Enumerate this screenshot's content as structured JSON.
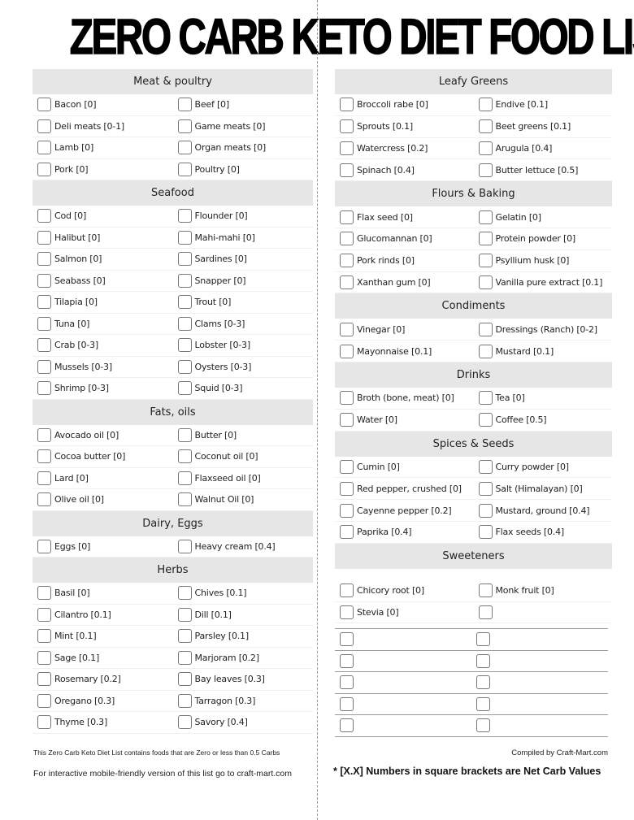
{
  "title": "ZERO CARB KETO DIET FOOD LIST",
  "left_column": [
    {
      "category": "Meat & poultry",
      "items": [
        "Bacon [0]",
        "Beef [0]",
        "Deli meats [0-1]",
        "Game meats [0]",
        "Lamb [0]",
        "Organ meats [0]",
        "Pork [0]",
        "Poultry [0]"
      ]
    },
    {
      "category": "Seafood",
      "items": [
        "Cod [0]",
        "Flounder [0]",
        "Halibut [0]",
        "Mahi-mahi [0]",
        "Salmon [0]",
        "Sardines [0]",
        "Seabass [0]",
        "Snapper [0]",
        "Tilapia [0]",
        "Trout [0]",
        "Tuna [0]",
        "Clams [0-3]",
        "Crab [0-3]",
        "Lobster [0-3]",
        "Mussels [0-3]",
        "Oysters [0-3]",
        "Shrimp [0-3]",
        "Squid [0-3]"
      ]
    },
    {
      "category": "Fats, oils",
      "items": [
        "Avocado oil [0]",
        "Butter [0]",
        "Cocoa butter [0]",
        "Coconut oil [0]",
        "Lard [0]",
        "Flaxseed oil [0]",
        "Olive oil [0]",
        "Walnut Oil [0]"
      ]
    },
    {
      "category": "Dairy, Eggs",
      "items": [
        "Eggs [0]",
        "Heavy cream [0.4]"
      ]
    },
    {
      "category": "Herbs",
      "items": [
        "Basil [0]",
        "Chives [0.1]",
        "Cilantro [0.1]",
        "Dill [0.1]",
        "Mint [0.1]",
        "Parsley [0.1]",
        "Sage [0.1]",
        "Marjoram [0.2]",
        "Rosemary [0.2]",
        "Bay leaves [0.3]",
        "Oregano [0.3]",
        "Tarragon [0.3]",
        "Thyme [0.3]",
        "Savory [0.4]"
      ]
    }
  ],
  "right_column": [
    {
      "category": "Leafy Greens",
      "items": [
        "Broccoli rabe [0]",
        "Endive [0.1]",
        "Sprouts [0.1]",
        "Beet greens [0.1]",
        "Watercress [0.2]",
        "Arugula [0.4]",
        "Spinach [0.4]",
        "Butter lettuce [0.5]"
      ]
    },
    {
      "category": "Flours & Baking",
      "items": [
        "Flax seed [0]",
        "Gelatin [0]",
        "Glucomannan [0]",
        "Protein powder [0]",
        "Pork rinds [0]",
        "Psyllium husk [0]",
        "Xanthan gum [0]",
        "Vanilla pure extract [0.1]"
      ]
    },
    {
      "category": "Condiments",
      "items": [
        "Vinegar [0]",
        "Dressings (Ranch) [0-2]",
        "Mayonnaise [0.1]",
        "Mustard [0.1]"
      ]
    },
    {
      "category": "Drinks",
      "items": [
        "Broth (bone, meat) [0]",
        "Tea [0]",
        "Water [0]",
        "Coffee [0.5]"
      ]
    },
    {
      "category": "Spices & Seeds",
      "items": [
        "Cumin [0]",
        "Curry powder [0]",
        "Red pepper, crushed [0]",
        "Salt (Himalayan) [0]",
        "Cayenne pepper [0.2]",
        "Mustard, ground [0.4]",
        "Paprika [0.4]",
        "Flax seeds [0.4]"
      ]
    },
    {
      "category": "Sweeteners",
      "items": [
        "Chicory root [0]",
        "Monk fruit [0]",
        "Stevia [0]",
        ""
      ]
    }
  ],
  "blank_rows_count": 5,
  "footer": {
    "carb_note": "This Zero Carb Keto Diet List contains foods that are Zero or less than 0.5 Carbs",
    "mobile_note": "For interactive mobile-friendly version of this list go to craft-mart.com",
    "compiled_by": "Compiled by Craft-Mart.com",
    "net_carb_note": "* [X.X] Numbers in square brackets are Net Carb Values"
  },
  "colors": {
    "header_bg": "#e6e6e6",
    "checkbox_border": "#777777",
    "title": "#000000"
  }
}
